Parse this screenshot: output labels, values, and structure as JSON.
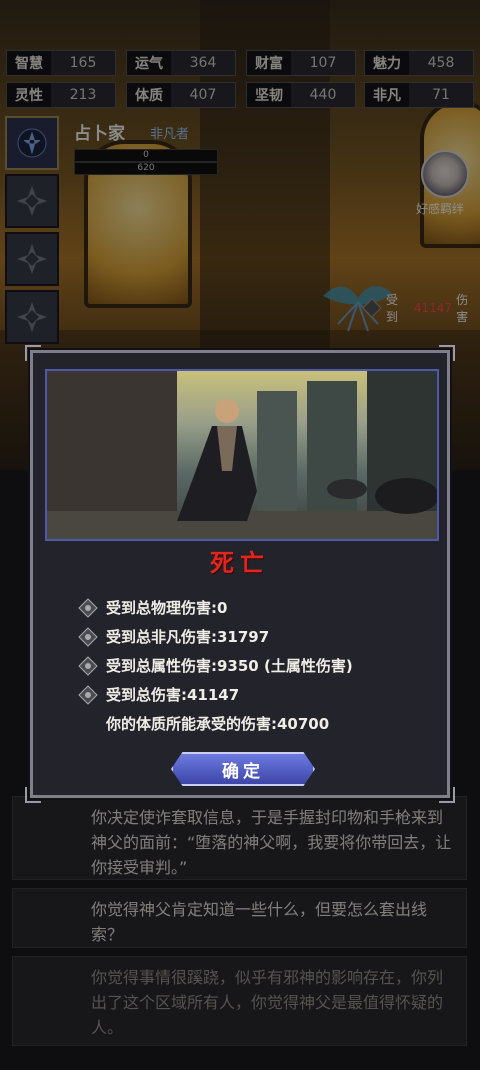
{
  "stats": [
    {
      "key": "智慧",
      "value": "165"
    },
    {
      "key": "运气",
      "value": "364"
    },
    {
      "key": "财富",
      "value": "107"
    },
    {
      "key": "魅力",
      "value": "458"
    },
    {
      "key": "灵性",
      "value": "213"
    },
    {
      "key": "体质",
      "value": "407"
    },
    {
      "key": "坚韧",
      "value": "440"
    },
    {
      "key": "非凡",
      "value": "71"
    }
  ],
  "hero": {
    "name": "占卜家",
    "rank": "非凡者",
    "bar_top": "0",
    "bar_bottom": "620"
  },
  "favor": {
    "label": "好感羁绊"
  },
  "damage_tag": {
    "prefix": "受到",
    "amount": "41147",
    "suffix": "伤害"
  },
  "modal": {
    "title": "死亡",
    "lines": [
      {
        "text": "受到总物理伤害:0",
        "icon": "diamond-rune-icon"
      },
      {
        "text": "受到总非凡伤害:31797",
        "icon": "diamond-rune-icon"
      },
      {
        "text": "受到总属性伤害:9350 (土属性伤害)",
        "icon": "diamond-rune-icon"
      },
      {
        "text": "受到总伤害:41147",
        "icon": "diamond-rune-icon"
      },
      {
        "text": "你的体质所能承受的伤害:40700",
        "icon": ""
      }
    ],
    "confirm_label": "确定"
  },
  "story": [
    "你决定使诈套取信息，于是手握封印物和手枪来到神父的面前：“堕落的神父啊，我要将你带回去，让你接受审判。”",
    "你觉得神父肯定知道一些什么，但要怎么套出线索？",
    "你觉得事情很蹊跷，似乎有邪神的影响存在，你列出了这个区域所有人，你觉得神父是最值得怀疑的人。"
  ],
  "colors": {
    "accent": "#e0261d",
    "button": "#4d58c4",
    "panel": "#23232b"
  }
}
